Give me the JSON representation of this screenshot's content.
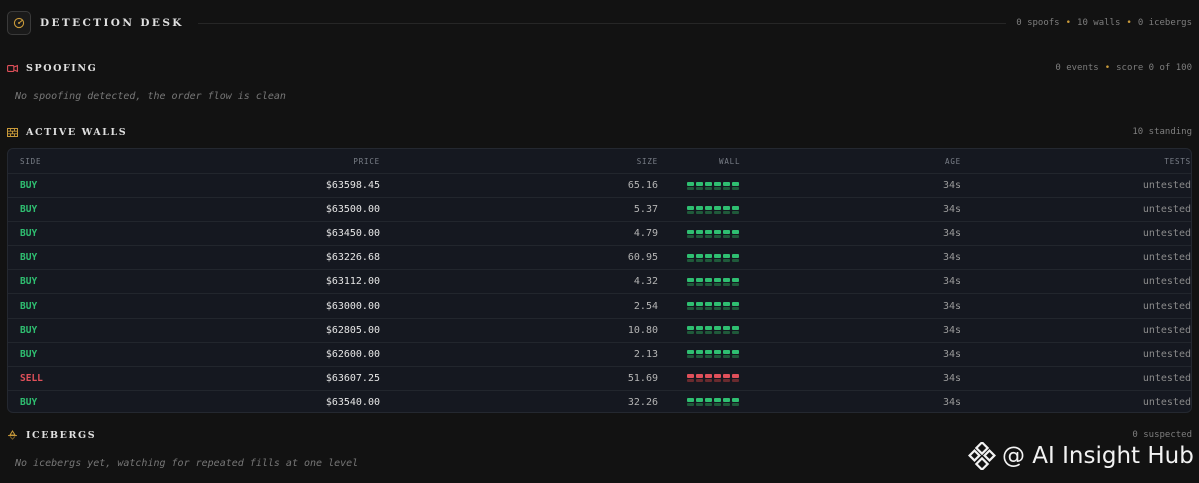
{
  "header": {
    "title": "DETECTION DESK",
    "stats": [
      "0 spoofs",
      "10 walls",
      "0 icebergs"
    ]
  },
  "spoofing": {
    "title": "SPOOFING",
    "meta": [
      "0 events",
      "score 0 of 100"
    ],
    "empty": "No spoofing detected, the order flow is clean"
  },
  "walls": {
    "title": "ACTIVE WALLS",
    "meta": "10 standing",
    "columns": [
      "SIDE",
      "PRICE",
      "SIZE",
      "WALL",
      "AGE",
      "TESTS"
    ],
    "rows": [
      {
        "side": "BUY",
        "price": "$63598.45",
        "size": "65.16",
        "age": "34s",
        "tests": "untested"
      },
      {
        "side": "BUY",
        "price": "$63500.00",
        "size": "5.37",
        "age": "34s",
        "tests": "untested"
      },
      {
        "side": "BUY",
        "price": "$63450.00",
        "size": "4.79",
        "age": "34s",
        "tests": "untested"
      },
      {
        "side": "BUY",
        "price": "$63226.68",
        "size": "60.95",
        "age": "34s",
        "tests": "untested"
      },
      {
        "side": "BUY",
        "price": "$63112.00",
        "size": "4.32",
        "age": "34s",
        "tests": "untested"
      },
      {
        "side": "BUY",
        "price": "$63000.00",
        "size": "2.54",
        "age": "34s",
        "tests": "untested"
      },
      {
        "side": "BUY",
        "price": "$62805.00",
        "size": "10.80",
        "age": "34s",
        "tests": "untested"
      },
      {
        "side": "BUY",
        "price": "$62600.00",
        "size": "2.13",
        "age": "34s",
        "tests": "untested"
      },
      {
        "side": "SELL",
        "price": "$63607.25",
        "size": "51.69",
        "age": "34s",
        "tests": "untested"
      },
      {
        "side": "BUY",
        "price": "$63540.00",
        "size": "32.26",
        "age": "34s",
        "tests": "untested"
      }
    ]
  },
  "icebergs": {
    "title": "ICEBERGS",
    "meta": "0 suspected",
    "empty": "No icebergs yet, watching for repeated fills at one level"
  },
  "watermark": "@ AI Insight Hub",
  "colors": {
    "buy": "#2fbf71",
    "sell": "#e0505a",
    "accent": "#c99a3a",
    "spoof_icon": "#e0505a"
  }
}
